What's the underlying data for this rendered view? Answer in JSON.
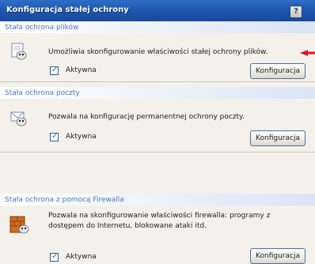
{
  "window": {
    "title": "Konfiguracja stałej ochrony",
    "help_label": "?"
  },
  "panels": [
    {
      "title": "Stała ochrona plików",
      "description": "Umożliwia skonfigurowanie właściwości stałej ochrony plików.",
      "checkbox_label": "Aktywna",
      "checked": true,
      "button_label": "Konfiguracja",
      "icon": "document-shield-icon"
    },
    {
      "title": "Stała ochrona poczty",
      "description": "Pozwala na konfigurację permanentnej ochrony poczty.",
      "checkbox_label": "Aktywna",
      "checked": true,
      "button_label": "Konfiguracja",
      "icon": "mail-shield-icon"
    },
    {
      "title": "Stała ochrona z pomocą Firewalla",
      "description": "Pozwala na skonfigurowanie właściwości firewalla: programy z dostępem do Internetu, blokowane ataki itd.",
      "checkbox_label": "Aktywna",
      "checked": true,
      "button_label": "Konfiguracja",
      "icon": "firewall-icon"
    }
  ],
  "colors": {
    "titlebar": "#1f57b0",
    "panel_title": "#4a78c9",
    "annotation_arrow": "#e8102a"
  }
}
